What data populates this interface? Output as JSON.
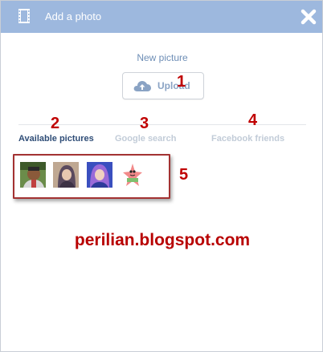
{
  "dialog": {
    "title": "Add a photo",
    "icons": {
      "title": "film-icon",
      "close": "close-icon"
    }
  },
  "upload_section": {
    "heading": "New picture",
    "button_label": "Upload",
    "button_icon": "cloud-upload-icon"
  },
  "tabs": [
    {
      "label": "Available pictures",
      "active": true
    },
    {
      "label": "Google search",
      "active": false
    },
    {
      "label": "Facebook friends",
      "active": false
    }
  ],
  "thumbnails": [
    {
      "name": "thumbnail-man"
    },
    {
      "name": "thumbnail-woman"
    },
    {
      "name": "thumbnail-woman-blue"
    },
    {
      "name": "thumbnail-starfish-cartoon"
    }
  ],
  "annotations": [
    "1",
    "2",
    "3",
    "4",
    "5"
  ],
  "watermark": "perilian.blogspot.com",
  "colors": {
    "titlebar": "#9db8de",
    "annotation": "#c00000",
    "active_tab": "#2f4d77",
    "inactive_tab": "#c2ccd8"
  }
}
